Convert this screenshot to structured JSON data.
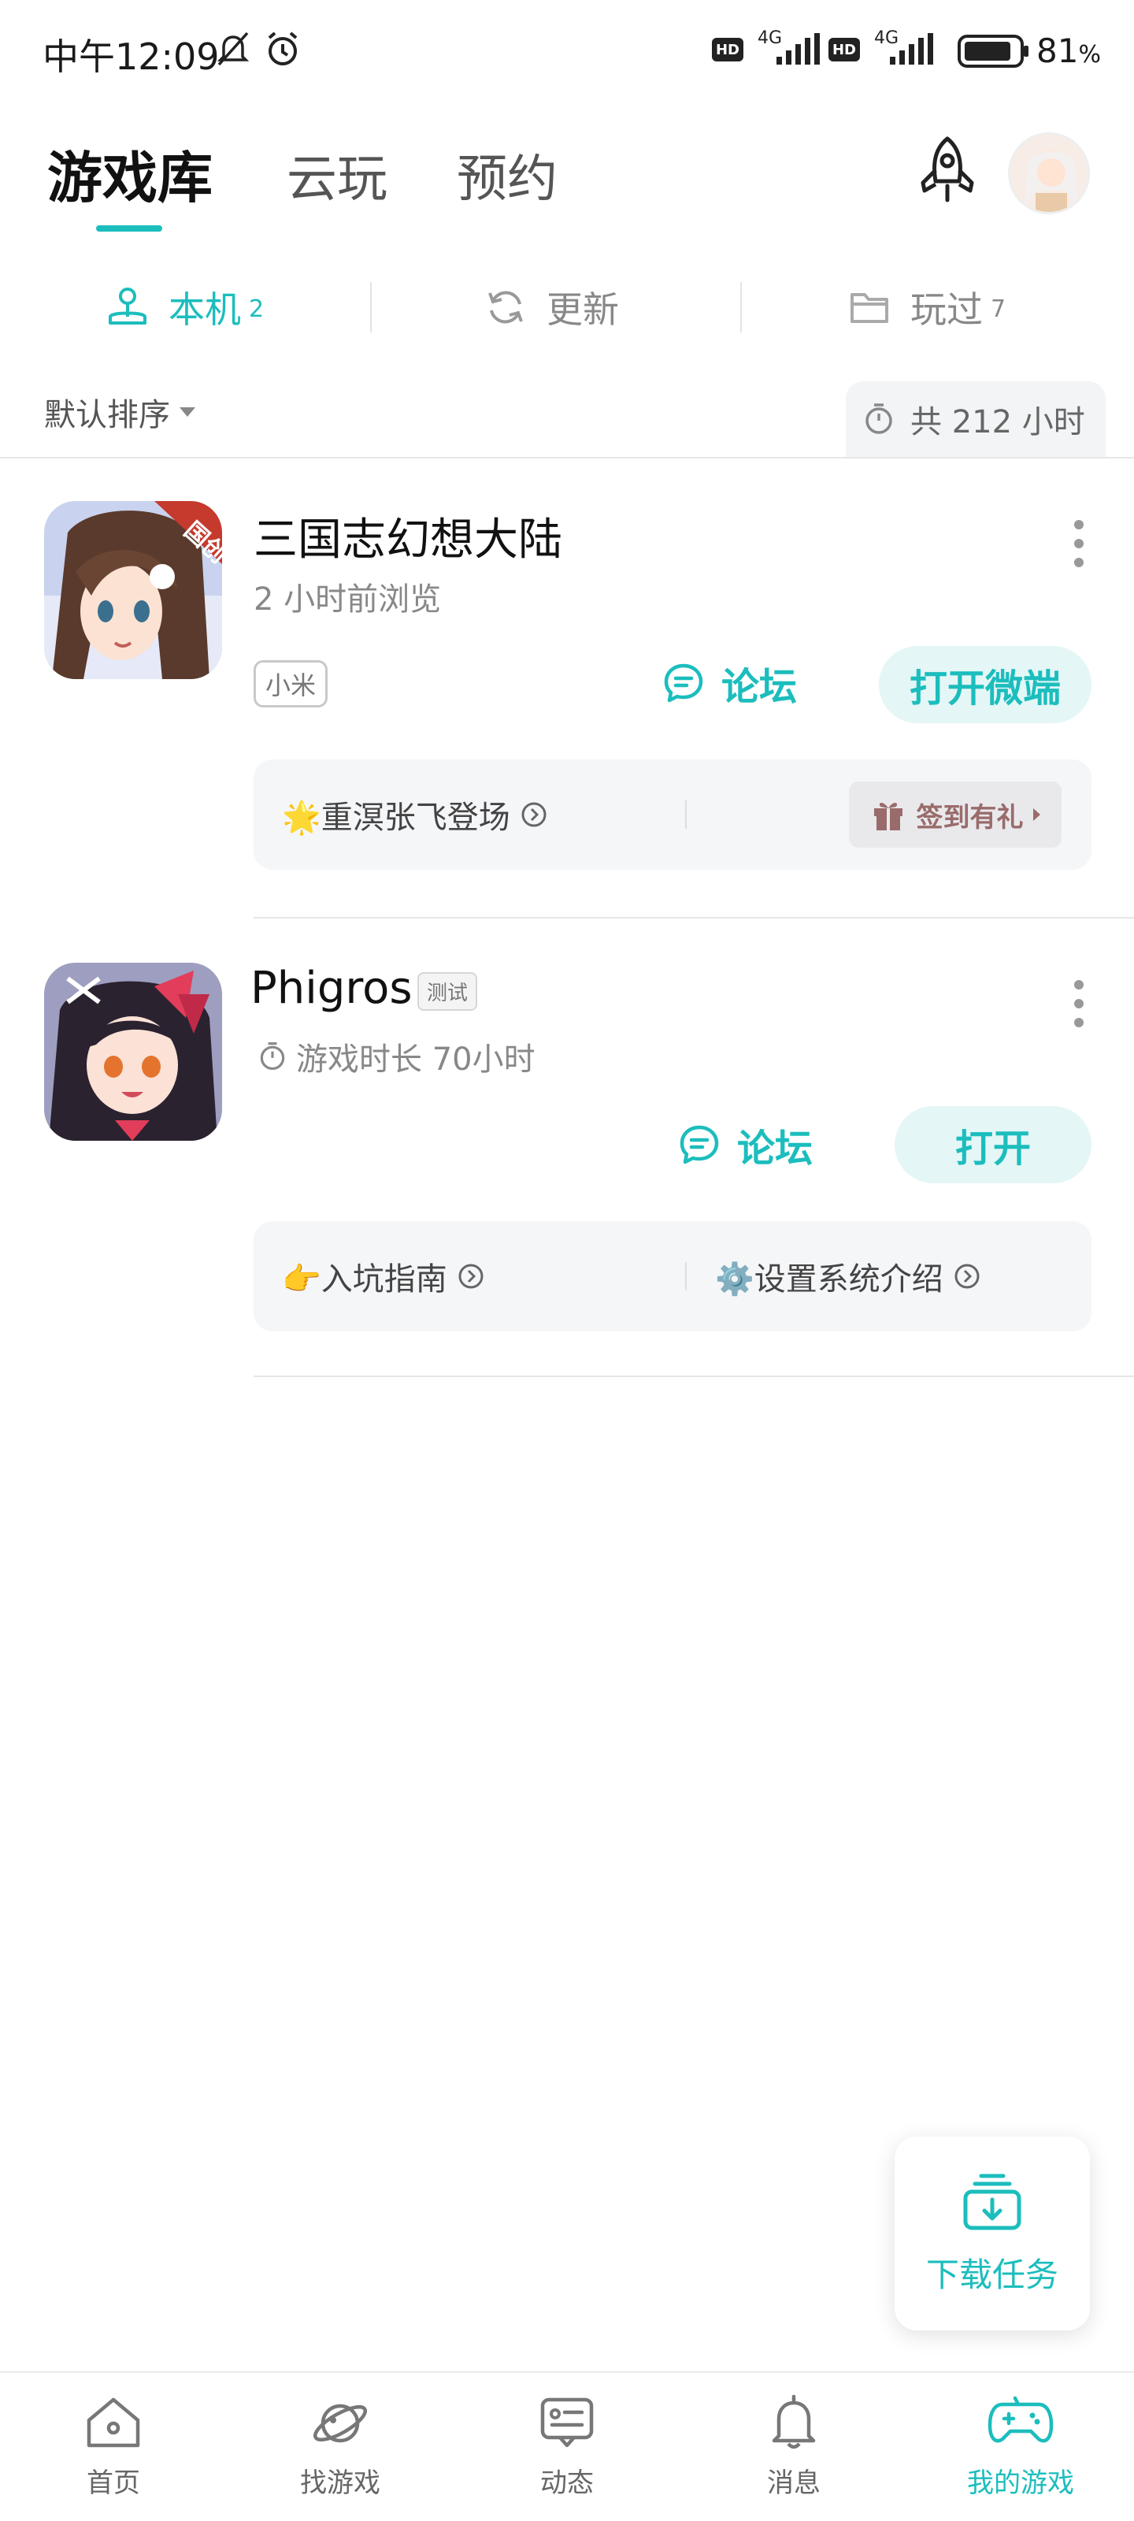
{
  "status_bar": {
    "time": "中午12:09",
    "network_1": "4G",
    "network_2": "4G",
    "hd_1": "HD",
    "hd_2": "HD",
    "battery_value": "81",
    "battery_unit": "%",
    "icons": [
      "bell-off-icon",
      "alarm-icon",
      "signal-icon",
      "battery-icon"
    ]
  },
  "header": {
    "tabs": [
      {
        "label": "游戏库",
        "active": true
      },
      {
        "label": "云玩",
        "active": false
      },
      {
        "label": "预约",
        "active": false
      }
    ],
    "icons": [
      "rocket-icon",
      "avatar"
    ]
  },
  "sub_tabs": [
    {
      "label": "本机",
      "count": "2",
      "icon": "joystick-icon",
      "active": true
    },
    {
      "label": "更新",
      "count": "",
      "icon": "refresh-icon",
      "active": false
    },
    {
      "label": "玩过",
      "count": "7",
      "icon": "folder-icon",
      "active": false
    }
  ],
  "toolbar": {
    "sort_label": "默认排序",
    "total_label": "共 212 小时"
  },
  "games": [
    {
      "title": "三国志幻想大陆",
      "subtitle": "2 小时前浏览",
      "tag": "小米",
      "forum_label": "论坛",
      "open_label": "打开微端",
      "panel_left": "🌟重溟张飞登场",
      "panel_right": "签到有礼"
    },
    {
      "title": "Phigros",
      "badge": "测试",
      "subtitle": "游戏时长 70小时",
      "forum_label": "论坛",
      "open_label": "打开",
      "panel_left": "👉入坑指南",
      "panel_right": "⚙️设置系统介绍"
    }
  ],
  "download": {
    "label": "下载任务"
  },
  "bottom_nav": [
    {
      "label": "首页",
      "icon": "home-icon",
      "active": false
    },
    {
      "label": "找游戏",
      "icon": "planet-icon",
      "active": false
    },
    {
      "label": "动态",
      "icon": "feed-icon",
      "active": false
    },
    {
      "label": "消息",
      "icon": "bell-icon",
      "active": false
    },
    {
      "label": "我的游戏",
      "icon": "gamepad-icon",
      "active": true
    }
  ],
  "colors": {
    "accent": "#1cbdbd",
    "panel_bg": "#f5f6f8"
  }
}
